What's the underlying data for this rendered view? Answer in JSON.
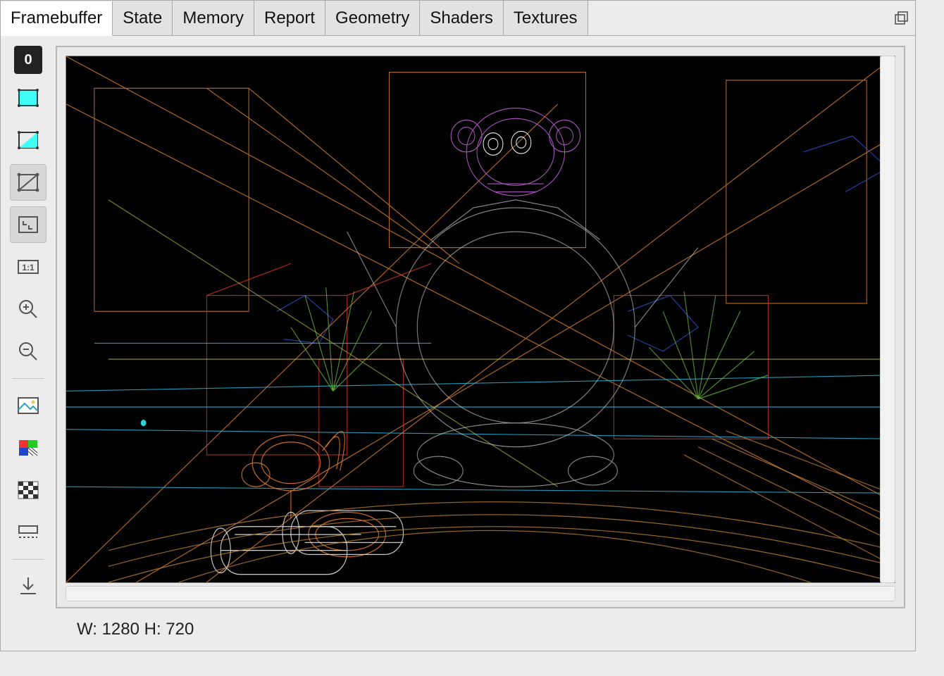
{
  "tabs": [
    {
      "label": "Framebuffer",
      "active": true
    },
    {
      "label": "State",
      "active": false
    },
    {
      "label": "Memory",
      "active": false
    },
    {
      "label": "Report",
      "active": false
    },
    {
      "label": "Geometry",
      "active": false
    },
    {
      "label": "Shaders",
      "active": false
    },
    {
      "label": "Textures",
      "active": false
    }
  ],
  "sidebar": {
    "frame_index": "0"
  },
  "viewport": {
    "width_label": "W:",
    "width_value": "1280",
    "height_label": "H:",
    "height_value": "720"
  }
}
